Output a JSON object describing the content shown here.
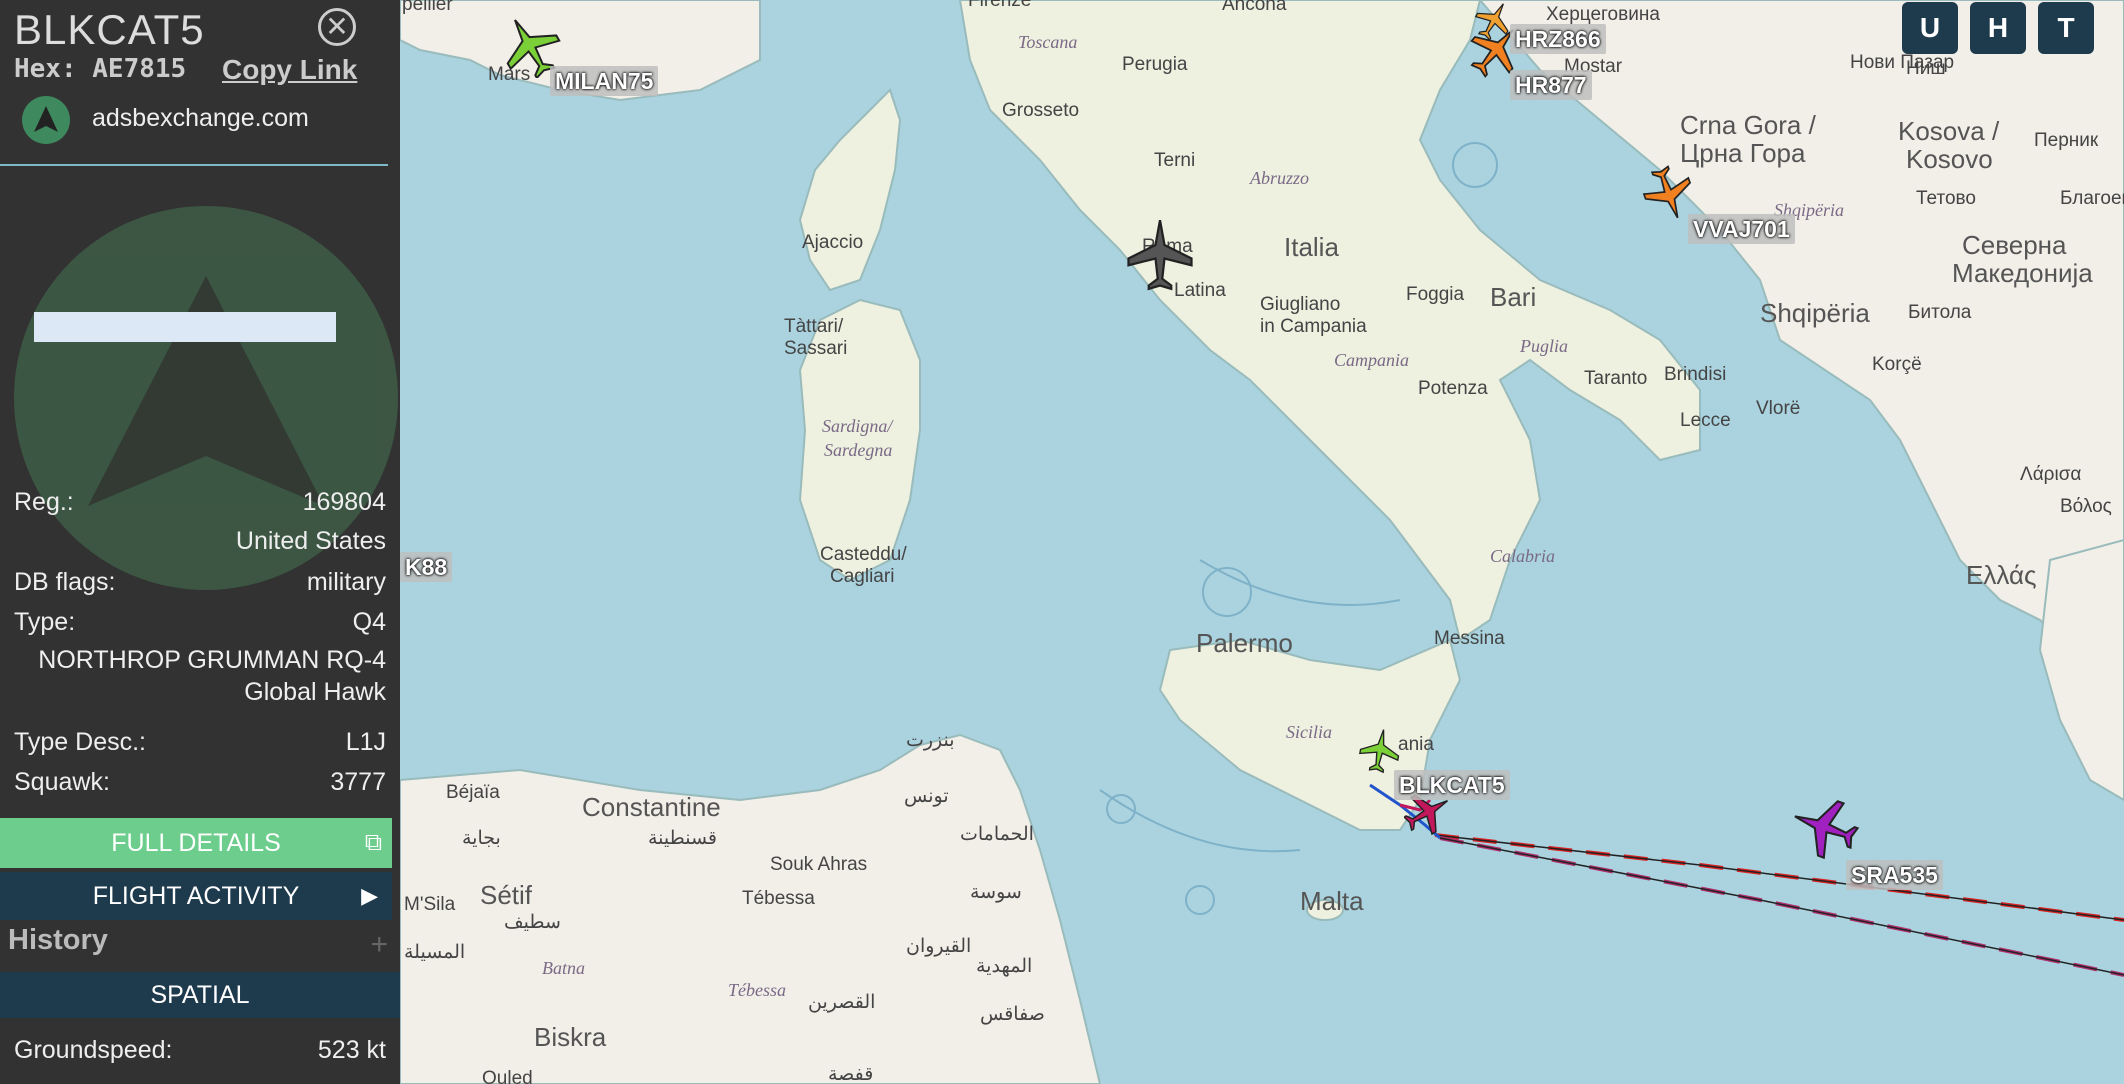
{
  "sidebar": {
    "callsign": "BLKCAT5",
    "close_icon": "close-icon",
    "hex": "Hex: AE7815",
    "copy_link": "Copy Link",
    "source": "adsbexchange.com",
    "reg_label": "Reg.:",
    "reg_value": "169804",
    "country": "United States",
    "dbflags_label": "DB flags:",
    "dbflags_value": "military",
    "type_label": "Type:",
    "type_value": "Q4",
    "type_full_1": "NORTHROP GRUMMAN RQ-4",
    "type_full_2": "Global Hawk",
    "typedesc_label": "Type Desc.:",
    "typedesc_value": "L1J",
    "squawk_label": "Squawk:",
    "squawk_value": "3777",
    "full_details": "FULL DETAILS",
    "flight_activity": "FLIGHT ACTIVITY",
    "history": "History",
    "spatial": "SPATIAL",
    "groundspeed_label": "Groundspeed:",
    "groundspeed_value": "523 kt"
  },
  "top_buttons": [
    "U",
    "H",
    "T"
  ],
  "aircraft_labels": {
    "milan": "MILAN75",
    "hrz": "HRZ866",
    "hr": "HR877",
    "vvaj": "VVAJ701",
    "k88": "K88",
    "blkcat": "BLKCAT5",
    "sra": "SRA535"
  },
  "map_labels": {
    "firenze": "Firenze",
    "ancona": "Ancona",
    "toscana": "Toscana",
    "perugia": "Perugia",
    "grosseto": "Grosseto",
    "terni": "Terni",
    "abruzzo": "Abruzzo",
    "roma": "Roma",
    "latina": "Latina",
    "italia": "Italia",
    "foggia": "Foggia",
    "bari": "Bari",
    "giugliano_1": "Giugliano",
    "giugliano_2": "in Campania",
    "campania": "Campania",
    "puglia": "Puglia",
    "taranto": "Taranto",
    "brindisi": "Brindisi",
    "potenza": "Potenza",
    "lecce": "Lecce",
    "calabria": "Calabria",
    "messina": "Messina",
    "palermo": "Palermo",
    "sicilia": "Sicilia",
    "catania": "ania",
    "malta": "Malta",
    "ajaccio": "Ajaccio",
    "tattari_1": "Tàttari/",
    "tattari_2": "Sassari",
    "sardigna_1": "Sardigna/",
    "sardigna_2": "Sardegna",
    "casteddu_1": "Casteddu/",
    "casteddu_2": "Cagliari",
    "marseille": "Mars",
    "pellier": "pellier",
    "hercegovina": "Херцеговина",
    "mostar": "Mostar",
    "novi_pazar": "Нови Пазар",
    "nis": "Ниш",
    "crna_gora_1": "Crna Gora /",
    "crna_gora_2": "Црна Гора",
    "kosova_1": "Kosova /",
    "kosova_2": "Kosovo",
    "pernik": "Перник",
    "blagoev": "Благоев",
    "tetovo": "Тетово",
    "shqiperia": "Shqipëria",
    "shqiperia_it": "Shqipëria",
    "severna_1": "Северна",
    "severna_2": "Македонија",
    "bitola": "Битола",
    "korce": "Korçë",
    "vlore": "Vlorë",
    "ellas": "Ελλάς",
    "larisa": "Λάρισα",
    "volos": "Βόλος",
    "constantine": "Constantine",
    "bejaia": "Béjaïa",
    "setif": "Sétif",
    "msila": "M'Sila",
    "biskra": "Biskra",
    "batna": "Batna",
    "souk_ahras": "Souk Ahras",
    "tebessa": "Tébessa",
    "tebessa_it": "Tébessa",
    "tunis_ar": "تونس",
    "bizerte_ar": "بنزرت",
    "sousse_ar": "سوسة",
    "kairouan_ar": "القيروان",
    "mahdia_ar": "المهدية",
    "sfax_ar": "صفاقس",
    "gafsa_ar": "قفصة",
    "kasserine_ar": "القصرين",
    "hammamet_ar": "الحمامات",
    "constantine_ar": "قسنطينة",
    "setif_ar": "سطيف",
    "bejaia_ar": "بجاية",
    "msila_ar": "المسيلة",
    "ouled": "Ouled"
  },
  "colors": {
    "sea": "#aad3df",
    "land": "#f2efe9",
    "sidebar_bg": "#323232",
    "green_btn": "#6ccd8d",
    "dark_btn": "#1e3a4d"
  }
}
